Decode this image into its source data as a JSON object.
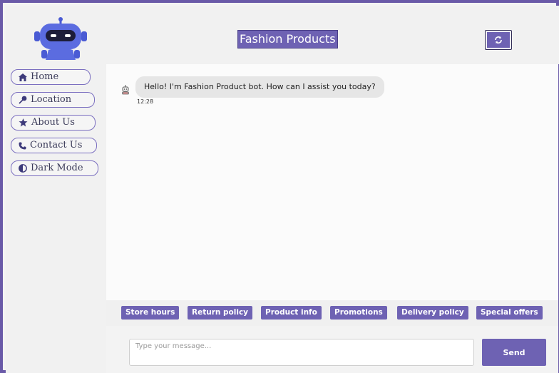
{
  "header": {
    "title": "Fashion Products",
    "logo_icon": "robot-icon",
    "refresh_icon": "refresh-icon",
    "accent_color": "#6e62b3"
  },
  "sidebar": {
    "items": [
      {
        "label": "Home",
        "icon": "home-icon"
      },
      {
        "label": "Location",
        "icon": "pin-icon"
      },
      {
        "label": "About Us",
        "icon": "star-icon"
      },
      {
        "label": "Contact Us",
        "icon": "phone-icon"
      },
      {
        "label": "Dark Mode",
        "icon": "contrast-icon"
      }
    ]
  },
  "chat": {
    "messages": [
      {
        "sender": "bot",
        "text": "Hello! I'm Fashion Product bot. How can I assist you today?",
        "time": "12:28"
      }
    ]
  },
  "quick_replies": [
    "Store hours",
    "Return policy",
    "Product info",
    "Promotions",
    "Delivery policy",
    "Special offers"
  ],
  "composer": {
    "placeholder": "Type your message...",
    "value": "",
    "send_label": "Send"
  }
}
